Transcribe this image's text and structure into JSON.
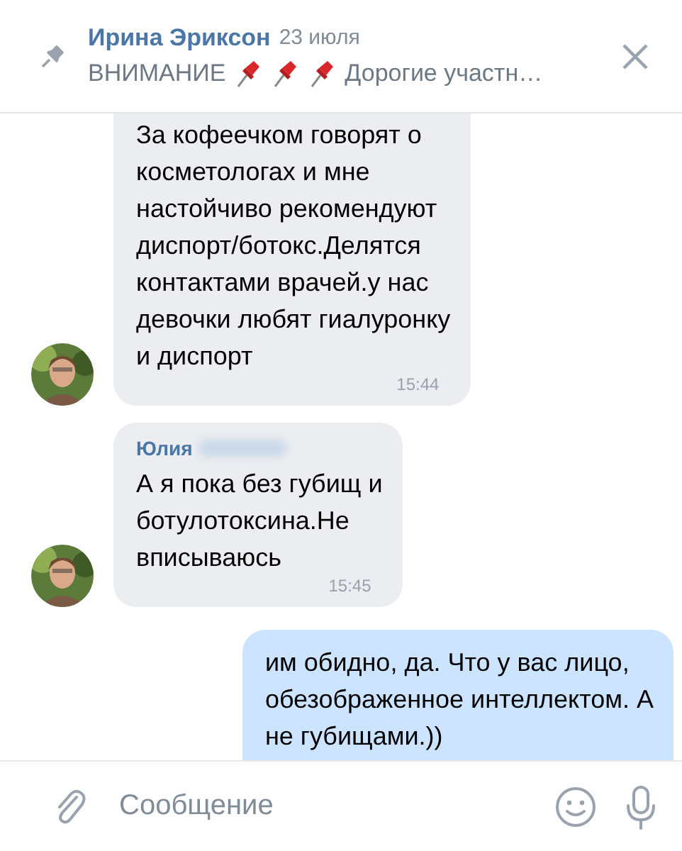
{
  "pinned": {
    "author": "Ирина Эриксон",
    "date": "23 июля",
    "preview": [
      {
        "kind": "text",
        "text": "ВНИМАНИЕ"
      },
      {
        "kind": "pin"
      },
      {
        "kind": "pin"
      },
      {
        "kind": "pin"
      },
      {
        "kind": "text",
        "text": "Дорогие участн…"
      }
    ]
  },
  "messages": [
    {
      "kind": "incoming",
      "text": "За кофеечком говорят о\nкосметологах и мне\nнастойчиво рекомендуют\nдиспорт/ботокс.Делятся\nконтактами врачей.у нас\nдевочки любят гиалуронку\nи диспорт",
      "time": "15:44"
    },
    {
      "kind": "incoming",
      "sender": "Юлия",
      "text": "А я пока без губищ и\nботулотоксина.Не\nвписываюсь",
      "time": "15:45"
    },
    {
      "kind": "outgoing",
      "text": "им обидно, да. Что у вас лицо,\nобезображенное интеллектом. А\nне губищами.))"
    }
  ],
  "composer": {
    "placeholder": "Сообщение"
  }
}
